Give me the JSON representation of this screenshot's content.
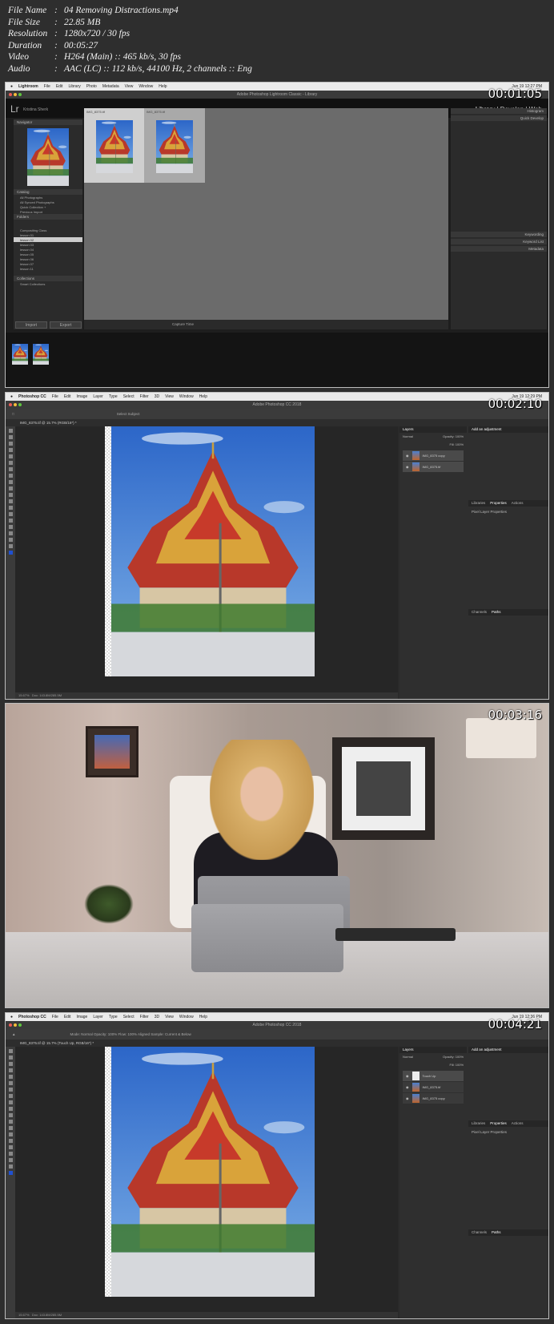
{
  "info": [
    {
      "key": "File Name",
      "value": "04 Removing Distractions.mp4"
    },
    {
      "key": "File Size",
      "value": "22.85 MB"
    },
    {
      "key": "Resolution",
      "value": "1280x720 / 30 fps"
    },
    {
      "key": "Duration",
      "value": "00:05:27"
    },
    {
      "key": "Video",
      "value": "H264 (Main) :: 465 kb/s, 30 fps"
    },
    {
      "key": "Audio",
      "value": "AAC (LC) :: 112 kb/s, 44100 Hz, 2 channels :: Eng"
    }
  ],
  "frames": [
    {
      "timestamp": "00:01:05",
      "menu": [
        "Lightroom",
        "File",
        "Edit",
        "Library",
        "Photo",
        "Metadata",
        "View",
        "Window",
        "Help"
      ],
      "clock": "Jun 19 12:27 PM",
      "window_title": "Adobe Photoshop Lightroom Classic - Library",
      "identity": "Kristina Sherk",
      "modules": [
        "Library",
        "Develop",
        "Web"
      ],
      "panels_left": {
        "navigator": "Navigator",
        "catalog": "Catalog",
        "catalog_items": [
          "All Photographs",
          "All Synced Photographs",
          "Quick Collection +",
          "Previous Import"
        ],
        "folders": "Folders",
        "folder_items": [
          "Compositing Class",
          "lesson 01",
          "lesson 02",
          "lesson 03",
          "lesson 04",
          "lesson 05",
          "lesson 06",
          "lesson 07",
          "lesson 11"
        ],
        "collections": "Collections",
        "collection_item": "Smart Collections"
      },
      "panels_right": {
        "histogram": "Histogram",
        "quick_develop": "Quick Develop",
        "keywording": "Keywording",
        "keyword_list": "Keyword List",
        "metadata": "Metadata"
      },
      "import": "Import",
      "export": "Export",
      "sort": "Capture Time",
      "thumbs": [
        "IMG_8375.tif",
        "IMG_8375.tif"
      ]
    },
    {
      "timestamp": "00:02:10",
      "menu": [
        "Photoshop CC",
        "File",
        "Edit",
        "Image",
        "Layer",
        "Type",
        "Select",
        "Filter",
        "3D",
        "View",
        "Window",
        "Help"
      ],
      "clock": "Jun 19 12:29 PM",
      "window_title": "Adobe Photoshop CC 2018",
      "doc_tab": "IMG_8375.tif @ 15.7% (RGB/16*) *",
      "options": "Select Subject",
      "panel_tabs": [
        "Layers"
      ],
      "adj_tabs": [
        "Libraries",
        "Properties",
        "Actions"
      ],
      "adj_title": "Add an adjustment",
      "props_title": "Pixel Layer Properties",
      "layers": [
        "IMG_8375 copy",
        "IMG_8375.tif"
      ],
      "blend": "Normal",
      "opacity": "Opacity: 100%",
      "fill": "Fill: 100%",
      "channels": [
        "Channels",
        "Paths"
      ],
      "zoom": "15.67%",
      "docsize": "Doc: 143.8M/285.5M"
    },
    {
      "timestamp": "00:03:16"
    },
    {
      "timestamp": "00:04:21",
      "menu": [
        "Photoshop CC",
        "File",
        "Edit",
        "Image",
        "Layer",
        "Type",
        "Select",
        "Filter",
        "3D",
        "View",
        "Window",
        "Help"
      ],
      "clock": "Jun 19 12:36 PM",
      "window_title": "Adobe Photoshop CC 2018",
      "doc_tab": "IMG_8375.tif @ 15.7% (Touch Up, RGB/16*) *",
      "options": "Mode: Normal   Opacity: 100%   Flow: 100%   Aligned   Sample: Current & Below",
      "panel_tabs": [
        "Layers"
      ],
      "adj_tabs": [
        "Libraries",
        "Properties",
        "Actions"
      ],
      "adj_title": "Add an adjustment",
      "props_title": "Pixel Layer Properties",
      "layers": [
        "Touch Up",
        "IMG_8375.tif",
        "IMG_8375 copy"
      ],
      "blend": "Normal",
      "opacity": "Opacity: 100%",
      "fill": "Fill: 100%",
      "channels": [
        "Channels",
        "Paths"
      ],
      "zoom": "15.67%",
      "docsize": "Doc: 143.8M/285.5M"
    }
  ]
}
